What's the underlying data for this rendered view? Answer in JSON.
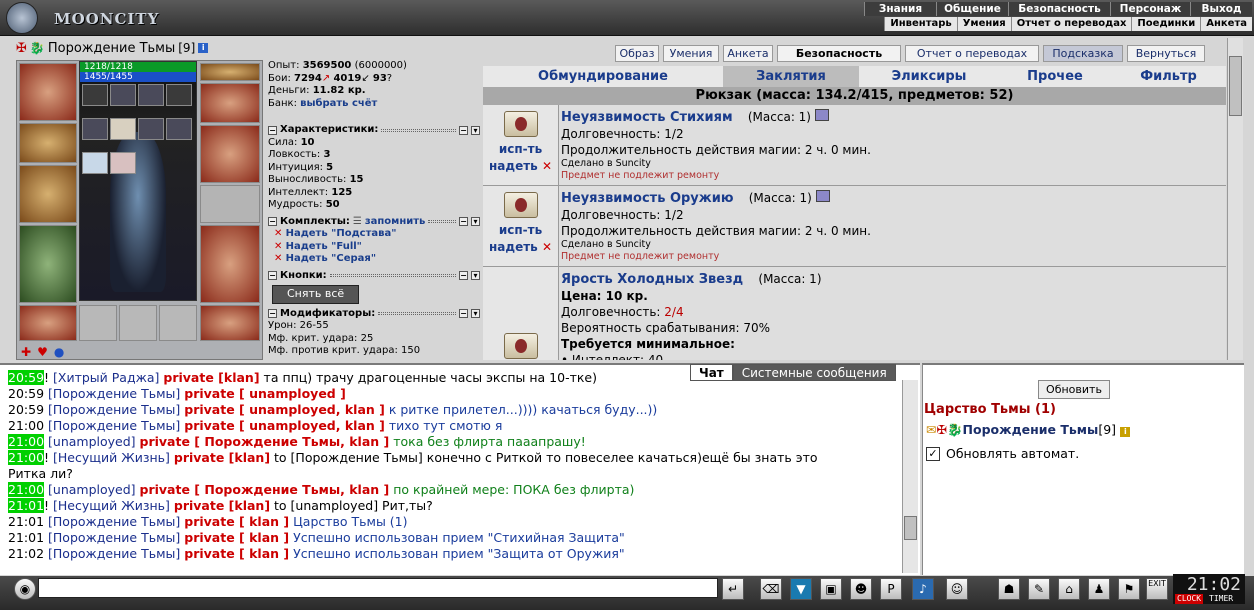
{
  "app": {
    "name": "MOONCITY"
  },
  "menu": {
    "top": [
      "Знания",
      "Общение",
      "Безопасность",
      "Персонаж",
      "Выход"
    ],
    "sub": [
      "Инвентарь",
      "Умения",
      "Отчет о переводах",
      "Поединки",
      "Анкета"
    ]
  },
  "char": {
    "name": "Порождение Тьмы",
    "level": "[9]",
    "hp": "1218/1218",
    "mp": "1455/1455"
  },
  "stats": {
    "exp_label": "Опыт:",
    "exp": "3569500",
    "exp_next": "(6000000)",
    "fights_label": "Бои:",
    "wins": "7294",
    "losses": "4019",
    "draws": "93",
    "money_label": "Деньги:",
    "money": "11.82 кр.",
    "bank_label": "Банк:",
    "bank_link": "выбрать счёт"
  },
  "sections": {
    "chars": "Характеристики:",
    "sets": "Комплекты:",
    "remember": "запомнить",
    "buttons": "Кнопки:",
    "mods": "Модификаторы:"
  },
  "attributes": [
    {
      "name": "Сила:",
      "value": "10"
    },
    {
      "name": "Ловкость:",
      "value": "3"
    },
    {
      "name": "Интуиция:",
      "value": "5"
    },
    {
      "name": "Выносливость:",
      "value": "15"
    },
    {
      "name": "Интеллект:",
      "value": "125"
    },
    {
      "name": "Мудрость:",
      "value": "50"
    }
  ],
  "sets": [
    "Надеть \"Подстава\"",
    "Надеть \"Full\"",
    "Надеть \"Серая\""
  ],
  "remove_all": "Снять всё",
  "modifiers": [
    {
      "name": "Урон:",
      "value": "26-55"
    },
    {
      "name": "Мф. крит. удара:",
      "value": "25"
    },
    {
      "name": "Мф. против крит. удара:",
      "value": "150"
    }
  ],
  "tabs": [
    "Образ",
    "Умения",
    "Анкета",
    "Безопасность",
    "Отчет о переводах",
    "Подсказка",
    "Вернуться"
  ],
  "categories": [
    "Обмундирование",
    "Заклятия",
    "Эликсиры",
    "Прочее",
    "Фильтр"
  ],
  "backpack": "Рюкзак (масса: 134.2/415, предметов: 52)",
  "items": [
    {
      "title": "Неуязвимость Стихиям",
      "mass": "(Масса: 1)",
      "dur_label": "Долговечность:",
      "dur": "1/2",
      "extra": "Продолжительность действия магии: 2 ч. 0 мин.",
      "made": "Сделано в Suncity",
      "norepair": "Предмет не подлежит ремонту",
      "act1": "исп-ть",
      "act2": "надеть"
    },
    {
      "title": "Неуязвимость Оружию",
      "mass": "(Масса: 1)",
      "dur_label": "Долговечность:",
      "dur": "1/2",
      "extra": "Продолжительность действия магии: 2 ч. 0 мин.",
      "made": "Сделано в Suncity",
      "norepair": "Предмет не подлежит ремонту",
      "act1": "исп-ть",
      "act2": "надеть"
    },
    {
      "title": "Ярость Холодных Звезд",
      "mass": "(Масса: 1)",
      "price": "Цена: 10 кр.",
      "dur_label": "Долговечность:",
      "dur": "2/4",
      "extra": "Вероятность срабатывания: 70%",
      "req": "Требуется минимальное:",
      "req1": "• Интеллект: 40"
    }
  ],
  "chat": {
    "tab_chat": "Чат",
    "tab_sys": "Системные сообщения",
    "lines": [
      {
        "ts": "20:59",
        "hl": true,
        "pre": "! ",
        "nick": "[Хитрый Раджа]",
        "priv": "private [klan]",
        "msg": "та ппц) трачу драгоценные часы экспы на 10-тке)",
        "cls": "m-dark"
      },
      {
        "ts": "20:59",
        "hl": false,
        "pre": " ",
        "nick": "[Порождение Тьмы]",
        "priv": "private [ unamployed ]",
        "msg": "",
        "cls": "m-blue"
      },
      {
        "ts": "20:59",
        "hl": false,
        "pre": " ",
        "nick": "[Порождение Тьмы]",
        "priv": "private [ unamployed, klan ]",
        "msg": "к ритке прилетел...)))) качаться буду...))",
        "cls": "m-blue"
      },
      {
        "ts": "21:00",
        "hl": false,
        "pre": " ",
        "nick": "[Порождение Тьмы]",
        "priv": "private [ unamployed, klan ]",
        "msg": "тихо тут смотю я",
        "cls": "m-blue"
      },
      {
        "ts": "21:00",
        "hl": true,
        "pre": " ",
        "nick": "[unamployed]",
        "priv": "private [ Порождение Тьмы, klan ]",
        "msg": "тока без флирта пааапрашу!",
        "cls": "m-green"
      },
      {
        "ts": "21:00",
        "hl": true,
        "pre": "! ",
        "nick": "[Несущий Жизнь]",
        "priv": "private [klan]",
        "msg": "to [Порождение Тьмы] конечно с Риткой то повеселее качаться)ещё бы знать это",
        "cls": "m-dark"
      },
      {
        "ts": "",
        "hl": false,
        "pre": "",
        "nick": "",
        "priv": "",
        "msg": "Ритка ли?",
        "cls": "m-dark"
      },
      {
        "ts": "21:00",
        "hl": true,
        "pre": " ",
        "nick": "[unamployed]",
        "priv": "private [ Порождение Тьмы, klan ]",
        "msg": "по крайней мере: ПОКА без флирта)",
        "cls": "m-green"
      },
      {
        "ts": "21:01",
        "hl": true,
        "pre": "! ",
        "nick": "[Несущий Жизнь]",
        "priv": "private [klan]",
        "msg": "to [unamployed] Рит,ты?",
        "cls": "m-dark"
      },
      {
        "ts": "21:01",
        "hl": false,
        "pre": " ",
        "nick": "[Порождение Тьмы]",
        "priv": "private [ klan ]",
        "msg": "Царство Тьмы (1)",
        "cls": "m-blue"
      },
      {
        "ts": "21:01",
        "hl": false,
        "pre": " ",
        "nick": "[Порождение Тьмы]",
        "priv": "private [ klan ]",
        "msg": "Успешно использован прием \"Стихийная Защита\"",
        "cls": "m-blue"
      },
      {
        "ts": "21:02",
        "hl": false,
        "pre": " ",
        "nick": "[Порождение Тьмы]",
        "priv": "private [ klan ]",
        "msg": "Успешно использован прием \"Защита от Оружия\"",
        "cls": "m-blue"
      }
    ]
  },
  "right": {
    "refresh": "Обновить",
    "kingdom": "Царство Тьмы (1)",
    "member": "Порождение Тьмы",
    "member_lvl": "[9]",
    "auto": "Обновлять автомат."
  },
  "clock": {
    "time": "21:02",
    "clock_label": "CLOCK",
    "timer_label": "TIMER",
    "exit": "EXIT"
  }
}
